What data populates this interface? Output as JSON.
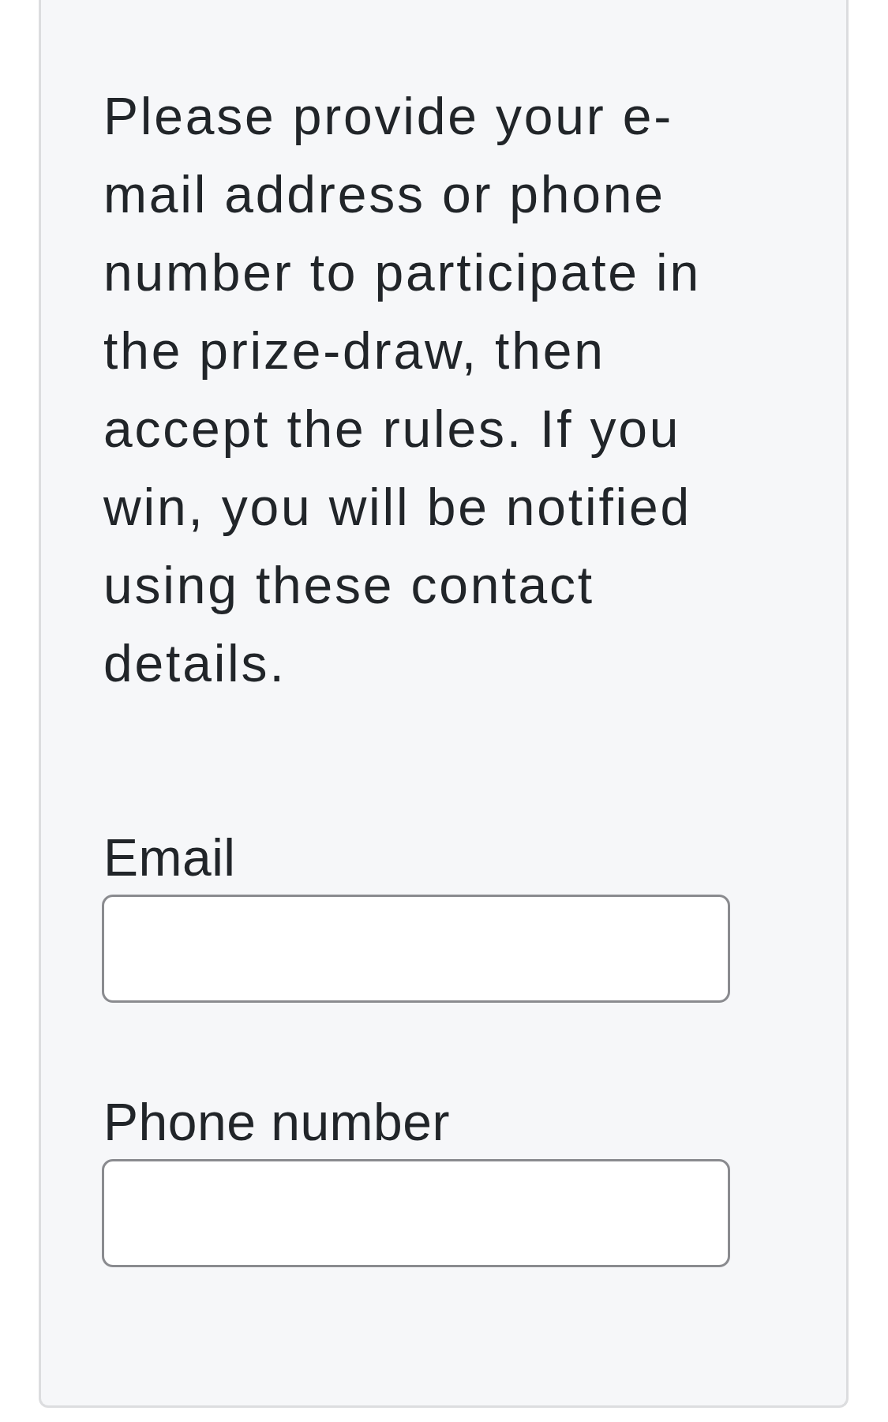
{
  "intro": {
    "text": "Please provide your e-mail address or phone number to participate in the prize-draw, then accept the rules. If you win, you will be notified using these contact details."
  },
  "fields": [
    {
      "label": "Email"
    },
    {
      "label": "Phone number"
    }
  ]
}
